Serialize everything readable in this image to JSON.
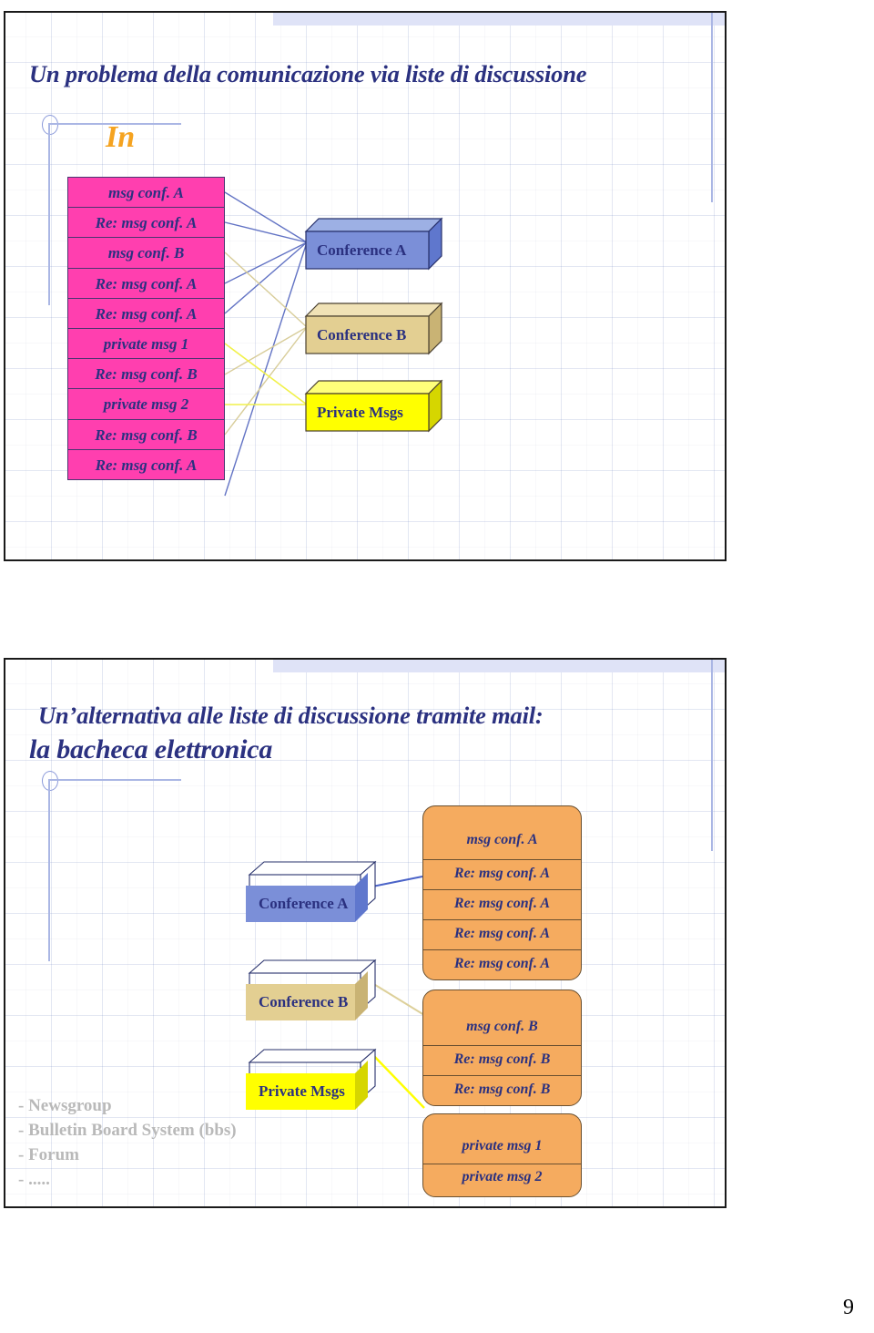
{
  "document": {
    "page_number": "9",
    "type": "presentation-handout",
    "slide_count": 2
  },
  "colors": {
    "title_blue": "#2b3180",
    "in_orange": "#f5a320",
    "inbox_pink": "#ff3faf",
    "conference_a_blue": "#7b8fd8",
    "conference_b_tan": "#e3cf92",
    "private_msgs_yellow": "#ffff00",
    "orange_group": "#f5ab5f",
    "bullet_grey": "#b9b9b9",
    "header_band": "#dfe3f7",
    "deco_line": "#aab6e4"
  },
  "slide1": {
    "title": "Un problema della comunicazione via liste di discussione",
    "inbox_label": "In",
    "inbox_messages": [
      "msg conf. A",
      "Re: msg conf. A",
      "msg conf. B",
      "Re: msg conf. A",
      "Re: msg conf. A",
      "private msg 1",
      "Re: msg conf. B",
      "private msg 2",
      "Re: msg conf. B",
      "Re: msg conf. A"
    ],
    "boxes": [
      {
        "label": "Conference A",
        "color": "#7b8fd8"
      },
      {
        "label": "Conference B",
        "color": "#e3cf92"
      },
      {
        "label": "Private Msgs",
        "color": "#ffff00"
      }
    ]
  },
  "slide2": {
    "title_line1": "Un’alternativa alle liste di discussione tramite mail:",
    "title_line2": "la bacheca elettronica",
    "boxes": [
      {
        "label": "Conference A",
        "color": "#7b8fd8"
      },
      {
        "label": "Conference B",
        "color": "#e3cf92"
      },
      {
        "label": "Private Msgs",
        "color": "#ffff00"
      }
    ],
    "message_groups": [
      {
        "name": "conference-a-messages",
        "items": [
          "msg conf. A",
          "Re: msg conf. A",
          "Re: msg conf. A",
          "Re: msg conf. A",
          "Re: msg conf. A"
        ]
      },
      {
        "name": "conference-b-messages",
        "items": [
          "msg conf. B",
          "Re: msg conf. B",
          "Re: msg conf. B"
        ]
      },
      {
        "name": "private-messages",
        "items": [
          "private msg 1",
          "private msg 2"
        ]
      }
    ],
    "bullets": [
      "- Newsgroup",
      "- Bulletin Board System (bbs)",
      "- Forum",
      "- ....."
    ]
  }
}
